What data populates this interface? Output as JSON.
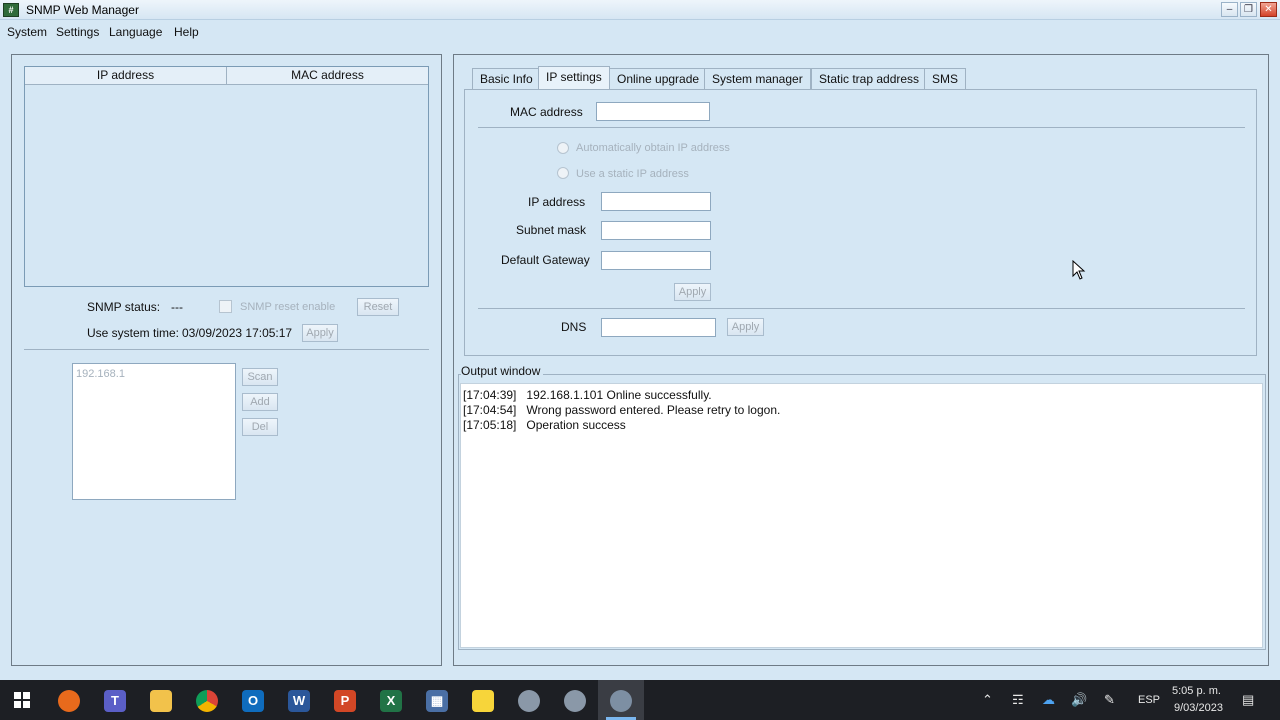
{
  "window": {
    "title": "SNMP Web Manager",
    "app_icon_text": "#"
  },
  "menu": {
    "items": [
      "System",
      "Settings",
      "Language",
      "Help"
    ]
  },
  "device_list": {
    "columns": [
      "IP address",
      "MAC address"
    ],
    "rows": []
  },
  "snmp": {
    "status_label": "SNMP status:",
    "status_value": "---",
    "reset_enable_label": "SNMP reset enable",
    "reset_button": "Reset",
    "system_time_label": "Use system time:",
    "system_time_value": "03/09/2023 17:05:17",
    "apply_button": "Apply"
  },
  "scan": {
    "ip_list": [
      "192.168.1"
    ],
    "scan_button": "Scan",
    "add_button": "Add",
    "del_button": "Del"
  },
  "tabs": {
    "items": [
      "Basic Info",
      "IP settings",
      "Online upgrade",
      "System manager",
      "Static trap address",
      "SMS"
    ],
    "active": "IP settings"
  },
  "ip_settings": {
    "mac_label": "MAC address",
    "mac_value": "",
    "auto_ip_label": "Automatically obtain IP address",
    "static_ip_label": "Use a static IP address",
    "ip_label": "IP address",
    "ip_value": "",
    "subnet_label": "Subnet mask",
    "subnet_value": "",
    "gateway_label": "Default Gateway",
    "gateway_value": "",
    "apply_button": "Apply",
    "dns_label": "DNS",
    "dns_value": "",
    "dns_apply_button": "Apply"
  },
  "output": {
    "title": "Output window",
    "lines": [
      {
        "time": "[17:04:39]",
        "message": "192.168.1.101 Online successfully."
      },
      {
        "time": "[17:04:54]",
        "message": "Wrong password entered. Please retry to logon."
      },
      {
        "time": "[17:05:18]",
        "message": "Operation success"
      }
    ]
  },
  "taskbar": {
    "apps": [
      "start-icon",
      "firefox-icon",
      "teams-icon",
      "file-explorer-icon",
      "chrome-icon",
      "outlook-icon",
      "word-icon",
      "powerpoint-icon",
      "excel-icon",
      "calculator-icon",
      "sticky-notes-icon",
      "app-icon-1",
      "app-icon-2",
      "snmp-manager-icon"
    ],
    "language": "ESP",
    "time": "5:05 p. m.",
    "date": "9/03/2023"
  },
  "colors": {
    "background": "#d5e7f4",
    "taskbar": "#1d1f24",
    "close_button": "#d4432a"
  }
}
